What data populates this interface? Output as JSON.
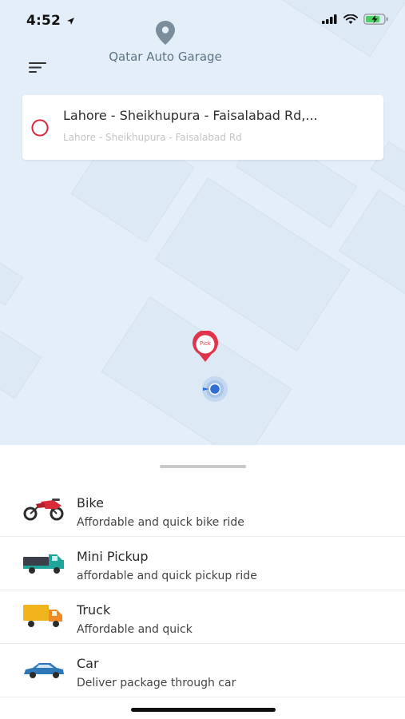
{
  "status_bar": {
    "time": "4:52"
  },
  "header": {
    "location_name": "Qatar Auto Garage"
  },
  "search": {
    "address_main": "Lahore - Sheikhupura - Faisalabad Rd,...",
    "address_sub": "Lahore - Sheikhupura - Faisalabad Rd"
  },
  "map": {
    "pin_label": "Pick"
  },
  "vehicles": [
    {
      "title": "Bike",
      "description": "Affordable and quick bike ride",
      "icon": "motorbike-icon"
    },
    {
      "title": "Mini Pickup",
      "description": "affordable and quick pickup ride",
      "icon": "pickup-truck-icon"
    },
    {
      "title": "Truck",
      "description": "Affordable and quick",
      "icon": "truck-icon"
    },
    {
      "title": "Car",
      "description": "Deliver package through car",
      "icon": "car-icon"
    }
  ],
  "colors": {
    "accent": "#e0344a",
    "map_bg": "#e3eef8",
    "location_blue": "#2f6fd6"
  }
}
